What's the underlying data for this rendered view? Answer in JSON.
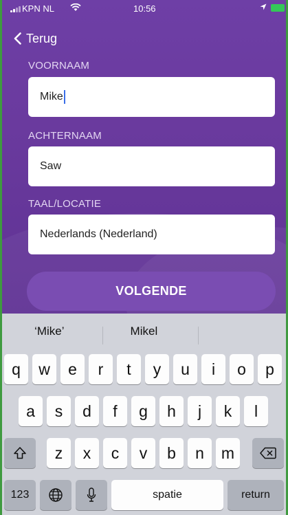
{
  "status_bar": {
    "carrier": "KPN NL",
    "time": "10:56"
  },
  "nav": {
    "back_label": "Terug"
  },
  "form": {
    "first_name_label": "VOORNAAM",
    "first_name_value": "Mike",
    "last_name_label": "ACHTERNAAM",
    "last_name_value": "Saw",
    "locale_label": "TAAL/LOCATIE",
    "locale_value": "Nederlands (Nederland)",
    "next_button": "VOLGENDE"
  },
  "keyboard": {
    "suggestions": [
      "‘Mike’",
      "Mikel",
      ""
    ],
    "row1": [
      "q",
      "w",
      "e",
      "r",
      "t",
      "y",
      "u",
      "i",
      "o",
      "p"
    ],
    "row2": [
      "a",
      "s",
      "d",
      "f",
      "g",
      "h",
      "j",
      "k",
      "l"
    ],
    "row3": [
      "z",
      "x",
      "c",
      "v",
      "b",
      "n",
      "m"
    ],
    "numbers_key": "123",
    "space_key": "spatie",
    "return_key": "return"
  },
  "colors": {
    "background": "#6b3a9c",
    "button": "#7a4db2",
    "battery": "#34c759",
    "caret": "#3a6ee8"
  }
}
